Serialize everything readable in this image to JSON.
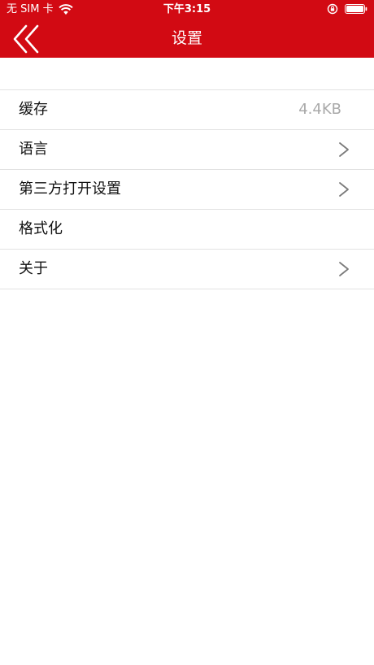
{
  "status_bar": {
    "carrier": "无 SIM 卡",
    "time": "下午3:15",
    "wifi_icon": "wifi-icon",
    "orientation_lock_icon": "orientation-lock-icon",
    "battery_icon": "battery-icon"
  },
  "nav": {
    "title": "设置",
    "back_icon": "double-chevron-left-icon"
  },
  "colors": {
    "header": "#d20a13",
    "divider": "#e2e2e2",
    "value_text": "#a9a9a9"
  },
  "settings": {
    "cache_label": "缓存",
    "cache_value": "4.4KB",
    "language_label": "语言",
    "third_party_label": "第三方打开设置",
    "format_label": "格式化",
    "about_label": "关于"
  }
}
